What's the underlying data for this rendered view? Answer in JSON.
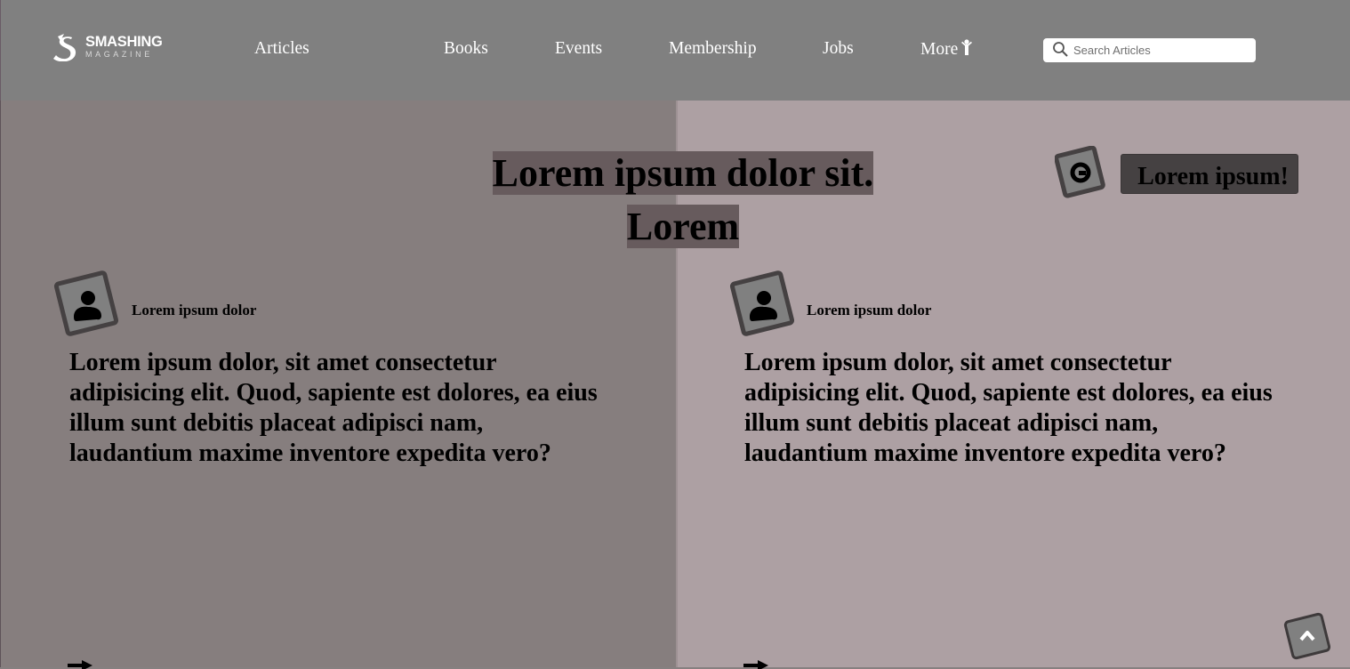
{
  "brand": {
    "name": "SMASHING",
    "sub": "MAGAZINE"
  },
  "nav": {
    "items": [
      "Articles",
      "Books",
      "Events",
      "Membership",
      "Jobs",
      "More"
    ],
    "more_icon": "person-arms-up-icon"
  },
  "search": {
    "placeholder": "Search Articles",
    "value": ""
  },
  "hero": {
    "headline_line1": "Lorem ipsum dolor sit.",
    "headline_line2": "Lorem",
    "badge_label": "Lorem ipsum!"
  },
  "cards": [
    {
      "author": "Lorem ipsum dolor",
      "body": "Lorem ipsum dolor, sit amet consectetur adipisicing elit. Quod, sapiente est dolores, ea eius illum sunt debitis placeat adipisci nam, laudantium maxime inventore expedita vero?"
    },
    {
      "author": "Lorem ipsum dolor",
      "body": "Lorem ipsum dolor, sit amet consectetur adipisicing elit. Quod, sapiente est dolores, ea eius illum sunt debitis placeat adipisci nam, laudantium maxime inventore expedita vero?"
    }
  ],
  "colors": {
    "header_bg": "#808080",
    "panel_left_bg": "#867e7e",
    "panel_right_bg": "#ada0a3",
    "headline_highlight": "#675b5d",
    "badge_bg": "#454142"
  }
}
